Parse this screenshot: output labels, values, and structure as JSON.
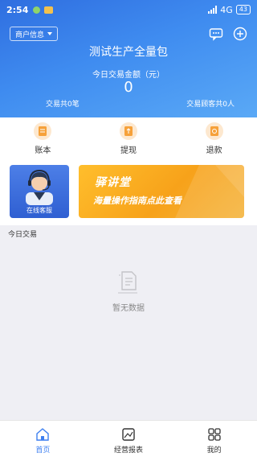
{
  "status_bar": {
    "time": "2:54",
    "network": "4G",
    "battery": "43"
  },
  "header": {
    "merchant_select": "商户信息",
    "store_name": "测试生产全量包",
    "amount_label": "今日交易金额（元）",
    "amount": "0",
    "tx_count": "交易共0笔",
    "customer_count": "交易顾客共0人"
  },
  "actions": [
    {
      "label": "账本",
      "icon": "ledger-icon"
    },
    {
      "label": "提现",
      "icon": "withdraw-icon"
    },
    {
      "label": "退款",
      "icon": "refund-icon"
    }
  ],
  "service": {
    "label": "在线客服",
    "icon": "customer-service-agent-icon"
  },
  "banner": {
    "title": "驿讲堂",
    "subtitle": "海量操作指南点此查看"
  },
  "today": {
    "title": "今日交易",
    "empty_text": "暂无数据"
  },
  "tabbar": [
    {
      "label": "首页",
      "icon": "home-icon",
      "active": true
    },
    {
      "label": "经营报表",
      "icon": "report-icon",
      "active": false
    },
    {
      "label": "我的",
      "icon": "grid-icon",
      "active": false
    }
  ],
  "colors": {
    "primary": "#3d7ff0",
    "banner": "#f7a21a",
    "action_icon_bg": "#fde8cf"
  }
}
